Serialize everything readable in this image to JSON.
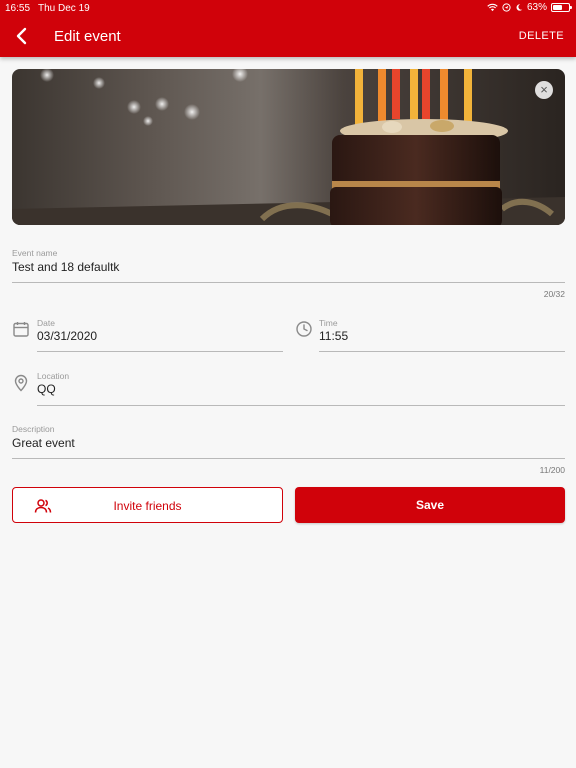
{
  "status_bar": {
    "time": "16:55",
    "date": "Thu Dec 19",
    "battery": "63%",
    "battery_level": 0.63,
    "icons": [
      "wifi-icon",
      "location-icon",
      "moon-icon",
      "battery-icon"
    ]
  },
  "app_bar": {
    "title": "Edit event",
    "back_icon": "chevron-left-icon",
    "delete_label": "DELETE"
  },
  "image": {
    "close_icon": "close-icon"
  },
  "form": {
    "event_name": {
      "label": "Event name",
      "value": "Test and 18 defaultk",
      "counter": "20/32"
    },
    "date": {
      "label": "Date",
      "value": "03/31/2020",
      "icon": "calendar-icon"
    },
    "time": {
      "label": "Time",
      "value": "11:55",
      "icon": "clock-icon"
    },
    "location": {
      "label": "Location",
      "value": "QQ",
      "icon": "location-pin-icon"
    },
    "description": {
      "label": "Description",
      "value": "Great event",
      "counter": "11/200"
    }
  },
  "actions": {
    "invite_label": "Invite friends",
    "invite_icon": "people-icon",
    "save_label": "Save"
  },
  "colors": {
    "accent": "#d0020a",
    "background": "#f7f7f7",
    "divider": "#b9b9b9"
  }
}
